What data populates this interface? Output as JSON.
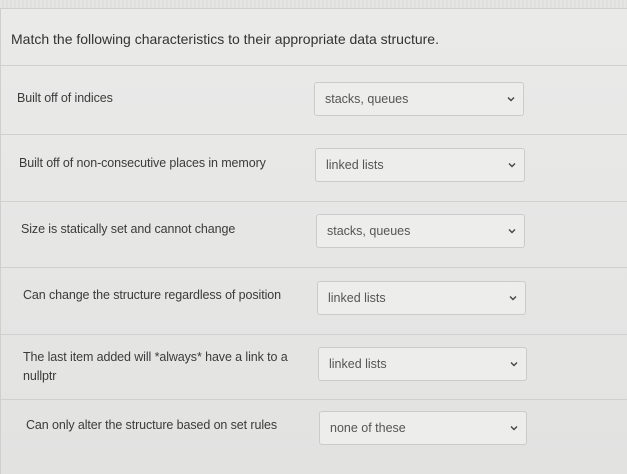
{
  "question": "Match the following characteristics to their appropriate data structure.",
  "rows": [
    {
      "prompt": "Built off of indices",
      "selected": "stacks, queues"
    },
    {
      "prompt": "Built off of non-consecutive places in memory",
      "selected": "linked lists"
    },
    {
      "prompt": "Size is statically set and cannot change",
      "selected": "stacks, queues"
    },
    {
      "prompt": "Can change the structure regardless of position",
      "selected": "linked lists"
    },
    {
      "prompt": "The last item added will *always* have a link to a nullptr",
      "selected": "linked lists"
    },
    {
      "prompt": "Can only alter the structure based on set rules",
      "selected": "none of these"
    }
  ],
  "icons": {
    "dropdown": "chevron-down-icon"
  }
}
